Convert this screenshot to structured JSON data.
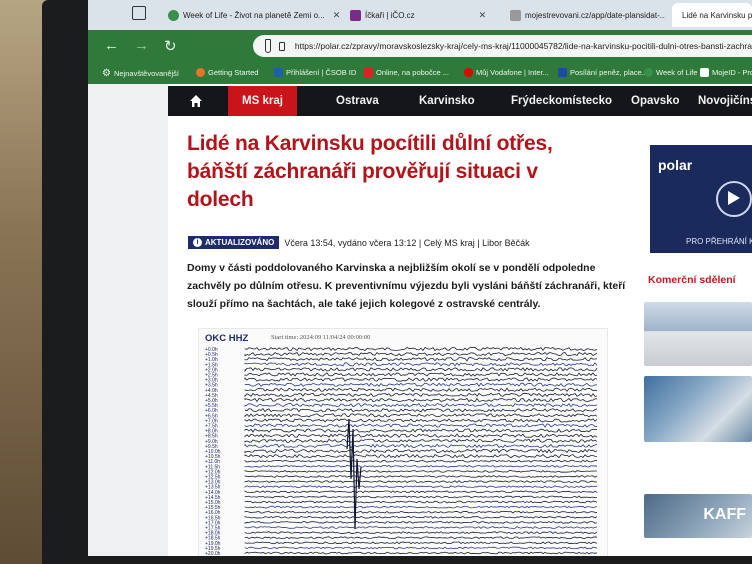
{
  "tabs": [
    {
      "label": "Week of Life - Život na planetě Zemi o...",
      "active": false
    },
    {
      "label": "Íčkaři | iČO.cz",
      "active": false
    },
    {
      "label": "mojestrevovani.cz/app/date-plansidat-...",
      "active": false
    },
    {
      "label": "Lidé na Karvinsku pocítili...",
      "active": true
    }
  ],
  "address_bar": {
    "url": "https://polar.cz/zpravy/moravskoslezsky-kraj/cely-ms-kraj/11000045782/lide-na-karvinsku-pocitili-dulni-otres-bansti-zachra"
  },
  "bookmarks": [
    {
      "label": "Nejnavštěvovanější",
      "icon": "gear-icon"
    },
    {
      "label": "Getting Started",
      "icon": "firefox-icon"
    },
    {
      "label": "Přihlášení | ČSOB ID",
      "icon": "bank-icon"
    },
    {
      "label": "Online, na pobočce ...",
      "icon": "id-icon"
    },
    {
      "label": "Můj Vodafone | Inter...",
      "icon": "vodafone-icon"
    },
    {
      "label": "Posílání peněz, place...",
      "icon": "paypal-icon"
    },
    {
      "label": "Week of Life",
      "icon": "globe-icon"
    },
    {
      "label": "MojeID - Pro u",
      "icon": "id-icon"
    }
  ],
  "site_nav": [
    "MS kraj",
    "Ostrava",
    "Karvinsko",
    "Frýdeckomístecko",
    "Opavsko",
    "Novojičínsk"
  ],
  "article": {
    "headline": "Lidé na Karvinsku pocítili důlní otřes, báňští záchranáři prověřují situaci v dolech",
    "badge": "AKTUALIZOVÁNO",
    "meta": "Včera 13:54, vydáno včera 13:12 | Celý MS kraj | Libor Běčák",
    "lead": "Domy v části poddolovaného Karvinska a nejbližším okolí se v pondělí odpoledne zachvěly po důlním otřesu. K preventivnímu výjezdu byli vysláni báňští záchranáři, kteří slouží přímo na šachtách, ale také jejich kolegové z ostravské centrály."
  },
  "seismogram": {
    "station": "OKC HHZ",
    "start_time": "Start time: 2024:09 11/04/24 00:00:00",
    "row_labels": [
      "+0.0h",
      "+0.5h",
      "+1.0h",
      "+1.5h",
      "+2.0h",
      "+2.5h",
      "+3.0h",
      "+3.5h",
      "+4.0h",
      "+4.5h",
      "+5.0h",
      "+5.5h",
      "+6.0h",
      "+6.5h",
      "+7.0h",
      "+7.5h",
      "+8.0h",
      "+8.5h",
      "+9.0h",
      "+9.5h",
      "+10.0h",
      "+10.5h",
      "+11.0h",
      "+11.5h",
      "+12.0h",
      "+12.5h",
      "+13.0h",
      "+13.5h",
      "+14.0h",
      "+14.5h",
      "+15.0h",
      "+15.5h",
      "+16.0h",
      "+16.5h",
      "+17.0h",
      "+17.5h",
      "+18.0h",
      "+18.5h",
      "+19.0h",
      "+19.5h",
      "+20.0h"
    ]
  },
  "sidebar": {
    "promo_logo": "polar",
    "promo_caption": "PRO PŘEHRÁNÍ K",
    "commercial_heading": "Komerční sdělení",
    "last_thumb_text": "KAFF"
  },
  "colors": {
    "brand_red": "#c9141a",
    "headline_red": "#b3141b",
    "nav_dark": "#14161a",
    "browser_green": "#2f7a3a",
    "badge_blue": "#1f2c6b"
  }
}
